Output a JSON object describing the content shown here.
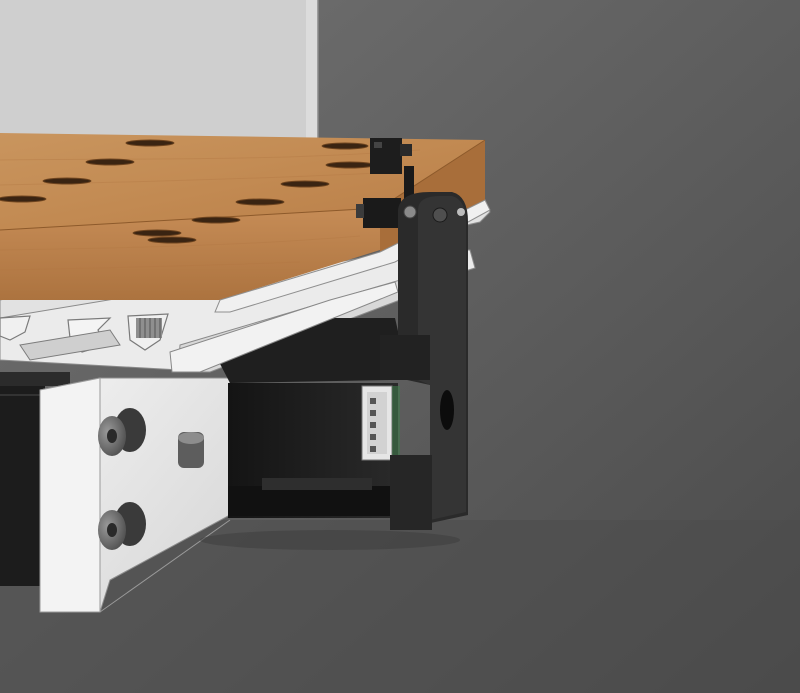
{
  "scene": {
    "subject": "cad-render",
    "colors": {
      "background_top": "#6a6a6a",
      "background_bottom": "#4a4a4a",
      "wood_top": "#c48a55",
      "wood_front": "#b77b45",
      "aluminum": "#e7e7e7",
      "aluminum_shade": "#bfbfbf",
      "motor_black": "#1a1a1a",
      "standoff_gray": "#6f6f6f"
    }
  }
}
